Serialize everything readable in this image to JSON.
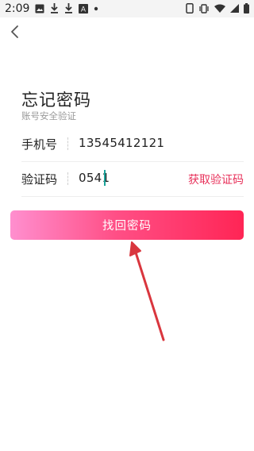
{
  "status_bar": {
    "time": "2:09",
    "icons_left": [
      "image-icon",
      "download-icon",
      "download-icon",
      "a-box-icon",
      "dot-icon"
    ],
    "icons_right": [
      "portrait-lock-icon",
      "vibrate-icon",
      "wifi-icon",
      "signal-icon",
      "battery-icon"
    ],
    "a_glyph": "A"
  },
  "header": {
    "title": "忘记密码",
    "subtitle": "账号安全验证"
  },
  "form": {
    "phone_label": "手机号",
    "phone_value": "13545412121",
    "code_label": "验证码",
    "code_value": "0541",
    "get_code_label": "获取验证码"
  },
  "submit_label": "找回密码",
  "colors": {
    "accent": "#e8325b",
    "button_start": "#ff8fcf",
    "button_end": "#ff2555",
    "annotation_arrow": "#d9363e",
    "cursor": "#1aa39a"
  }
}
